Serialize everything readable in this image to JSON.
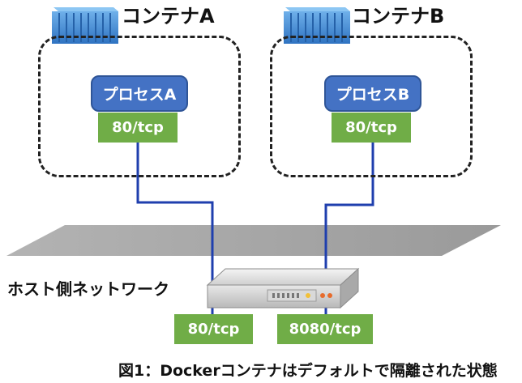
{
  "container_a": {
    "title": "コンテナA",
    "process_label": "プロセスA",
    "port_label": "80/tcp"
  },
  "container_b": {
    "title": "コンテナB",
    "process_label": "プロセスB",
    "port_label": "80/tcp"
  },
  "host": {
    "network_label": "ホスト側ネットワーク",
    "ports": [
      "80/tcp",
      "8080/tcp"
    ]
  },
  "caption": "図1：Dockerコンテナはデフォルトで隔離された状態",
  "colors": {
    "process": "#4472c4",
    "port": "#70ad47",
    "link": "#1f3fae",
    "network_plane": "#a6a6a6",
    "container_icon": "#4a8fd4"
  },
  "icons": [
    "shipping-container-icon",
    "server-icon"
  ]
}
